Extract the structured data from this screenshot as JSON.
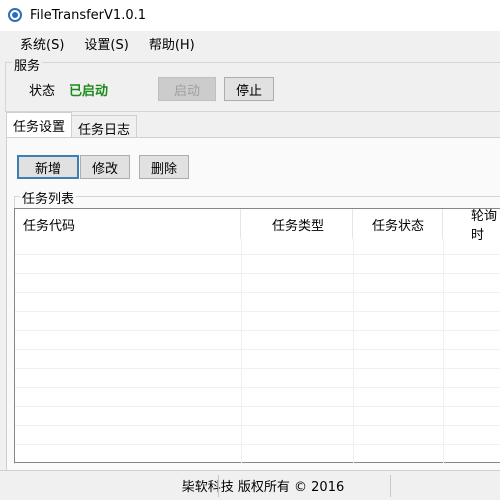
{
  "window": {
    "title": "FileTransferV1.0.1"
  },
  "menu": {
    "items": [
      "系统(S)",
      "设置(S)",
      "帮助(H)"
    ]
  },
  "service": {
    "legend": "服务",
    "status_label": "状态",
    "status_value": "已启动",
    "status_color": "#1a8a1a",
    "start_label": "启动",
    "stop_label": "停止"
  },
  "tabs": [
    {
      "label": "任务设置",
      "active": true
    },
    {
      "label": "任务日志",
      "active": false
    }
  ],
  "toolbar": {
    "add_label": "新增",
    "edit_label": "修改",
    "delete_label": "删除"
  },
  "task_list": {
    "legend": "任务列表",
    "columns": [
      "任务代码",
      "任务类型",
      "任务状态",
      "轮询时"
    ]
  },
  "statusbar": {
    "copyright": "枈软科技 版权所有 © 2016"
  },
  "icons": {
    "app": "app-logo-icon"
  }
}
